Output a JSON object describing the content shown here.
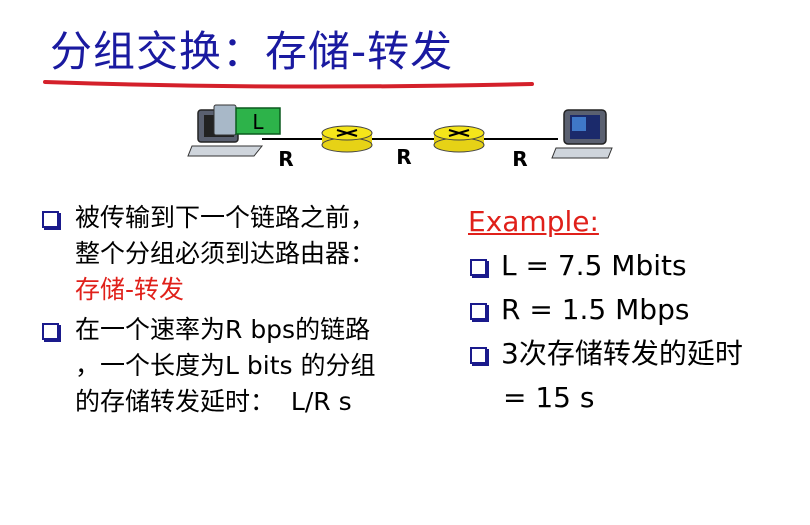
{
  "title": "分组交换：存储-转发",
  "network": {
    "packet_label": "L",
    "link_labels": [
      "R",
      "R",
      "R"
    ]
  },
  "bullets": [
    {
      "line1": "被传输到下一个链路之前，",
      "line2": "整个分组必须到达路由器：",
      "line3_red": "存储-转发"
    },
    {
      "line1": "在一个速率为R bps的链路",
      "line2": "，一个长度为L bits 的分组",
      "line3": "的存储转发延时：  L/R s"
    }
  ],
  "example": {
    "title": "Example:",
    "items": [
      "L = 7.5 Mbits",
      "R = 1.5 Mbps",
      "3次存储转发的延时"
    ],
    "continuation": "= 15 s"
  },
  "colors": {
    "title": "#1a1aa0",
    "underline": "#d4202a",
    "router": "#f5e51a",
    "packet": "#2db34a",
    "emphasis": "#e0201a"
  }
}
